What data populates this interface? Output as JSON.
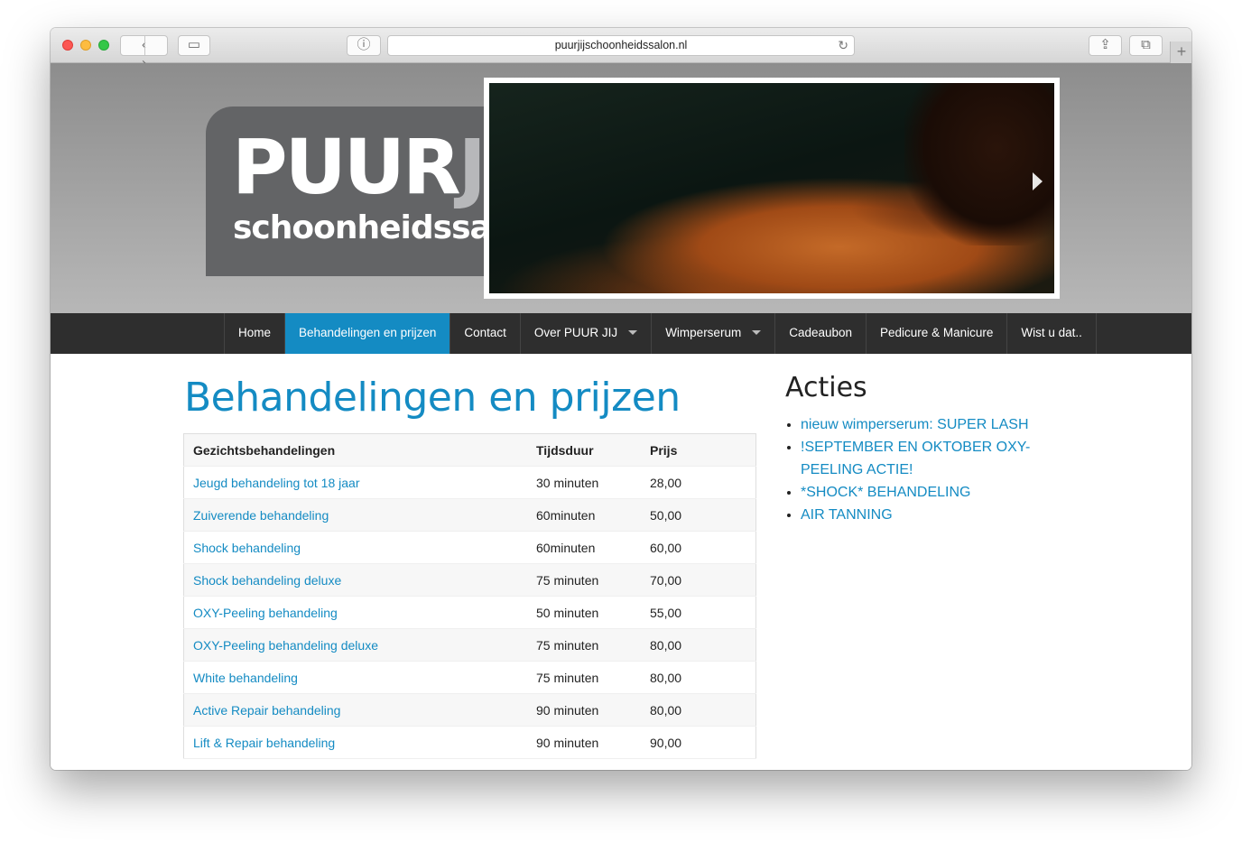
{
  "browser": {
    "url": "puurjijschoonheidssalon.nl",
    "back_glyph": "‹",
    "forward_glyph": "›",
    "sidebar_glyph": "▭",
    "info_glyph": "ⓘ",
    "reload_glyph": "↻",
    "share_glyph": "⇪",
    "tabs_glyph": "⧉",
    "newtab_glyph": "+"
  },
  "logo": {
    "main_white": "PUUR",
    "main_grey": "JIJ",
    "sub": "schoonheidssalon"
  },
  "nav": {
    "items": [
      {
        "label": "Home"
      },
      {
        "label": "Behandelingen en prijzen",
        "active": true
      },
      {
        "label": "Contact"
      },
      {
        "label": "Over PUUR JIJ",
        "dropdown": true
      },
      {
        "label": "Wimperserum",
        "dropdown": true
      },
      {
        "label": "Cadeaubon"
      },
      {
        "label": "Pedicure & Manicure"
      },
      {
        "label": "Wist u dat.."
      }
    ]
  },
  "main": {
    "title": "Behandelingen en prijzen",
    "table": {
      "headers": [
        "Gezichtsbehandelingen",
        "Tijdsduur",
        "Prijs"
      ],
      "rows": [
        [
          "Jeugd behandeling tot 18 jaar",
          "30 minuten",
          "28,00"
        ],
        [
          "Zuiverende behandeling",
          "60minuten",
          "50,00"
        ],
        [
          "Shock behandeling",
          "60minuten",
          "60,00"
        ],
        [
          "Shock behandeling deluxe",
          "75 minuten",
          "70,00"
        ],
        [
          "OXY-Peeling behandeling",
          "50 minuten",
          "55,00"
        ],
        [
          "OXY-Peeling behandeling deluxe",
          "75 minuten",
          "80,00"
        ],
        [
          "White behandeling",
          "75 minuten",
          "80,00"
        ],
        [
          "Active Repair behandeling",
          "90 minuten",
          "80,00"
        ],
        [
          "Lift & Repair behandeling",
          "90 minuten",
          "90,00"
        ]
      ]
    }
  },
  "sidebar": {
    "title": "Acties",
    "items": [
      "nieuw wimperserum: SUPER LASH",
      "!SEPTEMBER EN OKTOBER OXY-PEELING ACTIE!",
      "*SHOCK* BEHANDELING",
      "AIR TANNING"
    ]
  },
  "colors": {
    "accent": "#148bc3",
    "nav_bg": "#2e2e2e",
    "logo_bg": "#636466"
  },
  "icons": [
    "back-icon",
    "forward-icon",
    "sidebar-icon",
    "info-icon",
    "reload-icon",
    "share-icon",
    "tabs-icon",
    "new-tab-icon",
    "slider-next-icon",
    "dropdown-caret-icon"
  ]
}
